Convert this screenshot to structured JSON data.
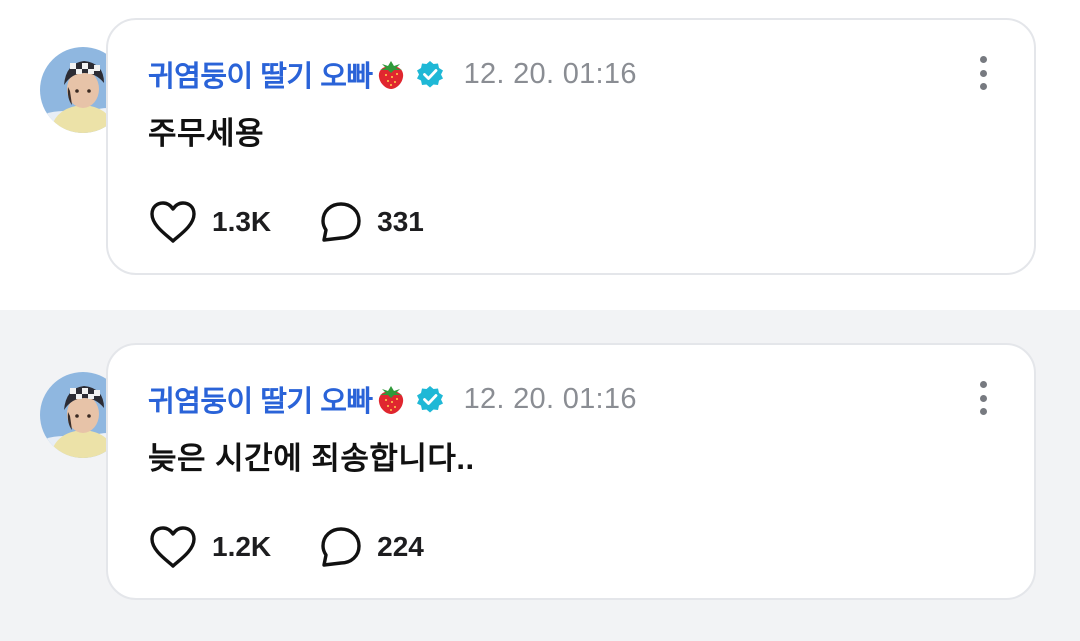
{
  "posts": [
    {
      "author": "귀염둥이 딸기 오빠",
      "timestamp": "12. 20. 01:16",
      "text": "주무세용",
      "likes": "1.3K",
      "comments": "331"
    },
    {
      "author": "귀염둥이 딸기 오빠",
      "timestamp": "12. 20. 01:16",
      "text": "늦은 시간에 죄송합니다..",
      "likes": "1.2K",
      "comments": "224"
    }
  ],
  "icons": {
    "author_suffix": "strawberry-icon",
    "badge": "verified-badge-icon",
    "menu": "more-vertical-icon",
    "like": "heart-outline-icon",
    "comment": "comment-bubble-icon"
  },
  "colors": {
    "author": "#2a63d8",
    "verified": "#1fb8d6",
    "timestamp": "#8a8d93",
    "card_border": "#e4e6ea",
    "lower_background": "#f2f3f5"
  }
}
